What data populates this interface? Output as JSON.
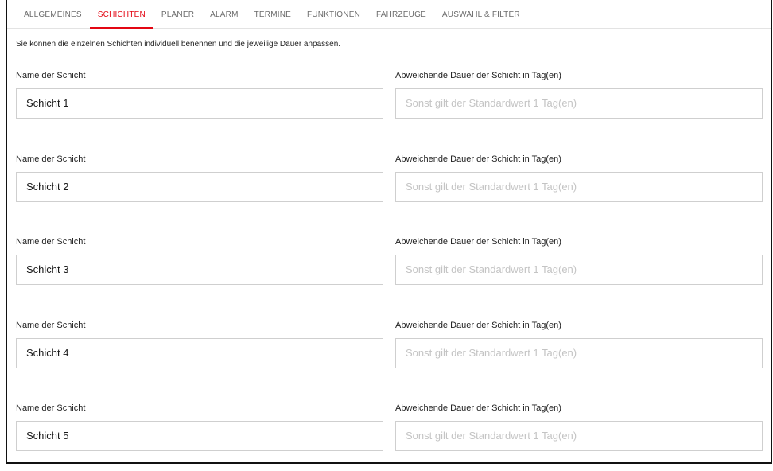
{
  "tabs": [
    {
      "label": "ALLGEMEINES",
      "active": false
    },
    {
      "label": "SCHICHTEN",
      "active": true
    },
    {
      "label": "PLANER",
      "active": false
    },
    {
      "label": "ALARM",
      "active": false
    },
    {
      "label": "TERMINE",
      "active": false
    },
    {
      "label": "FUNKTIONEN",
      "active": false
    },
    {
      "label": "FAHRZEUGE",
      "active": false
    },
    {
      "label": "AUSWAHL & FILTER",
      "active": false
    }
  ],
  "accent_color": "#e30613",
  "intro": "Sie können die einzelnen Schichten individuell benennen und die jeweilige Dauer anpassen.",
  "shifts": [
    {
      "name_label": "Name der Schicht",
      "name_value": "Schicht 1",
      "duration_label": "Abweichende Dauer der Schicht in Tag(en)",
      "duration_placeholder": "Sonst gilt der Standardwert 1 Tag(en)"
    },
    {
      "name_label": "Name der Schicht",
      "name_value": "Schicht 2",
      "duration_label": "Abweichende Dauer der Schicht in Tag(en)",
      "duration_placeholder": "Sonst gilt der Standardwert 1 Tag(en)"
    },
    {
      "name_label": "Name der Schicht",
      "name_value": "Schicht 3",
      "duration_label": "Abweichende Dauer der Schicht in Tag(en)",
      "duration_placeholder": "Sonst gilt der Standardwert 1 Tag(en)"
    },
    {
      "name_label": "Name der Schicht",
      "name_value": "Schicht 4",
      "duration_label": "Abweichende Dauer der Schicht in Tag(en)",
      "duration_placeholder": "Sonst gilt der Standardwert 1 Tag(en)"
    },
    {
      "name_label": "Name der Schicht",
      "name_value": "Schicht 5",
      "duration_label": "Abweichende Dauer der Schicht in Tag(en)",
      "duration_placeholder": "Sonst gilt der Standardwert 1 Tag(en)"
    }
  ]
}
